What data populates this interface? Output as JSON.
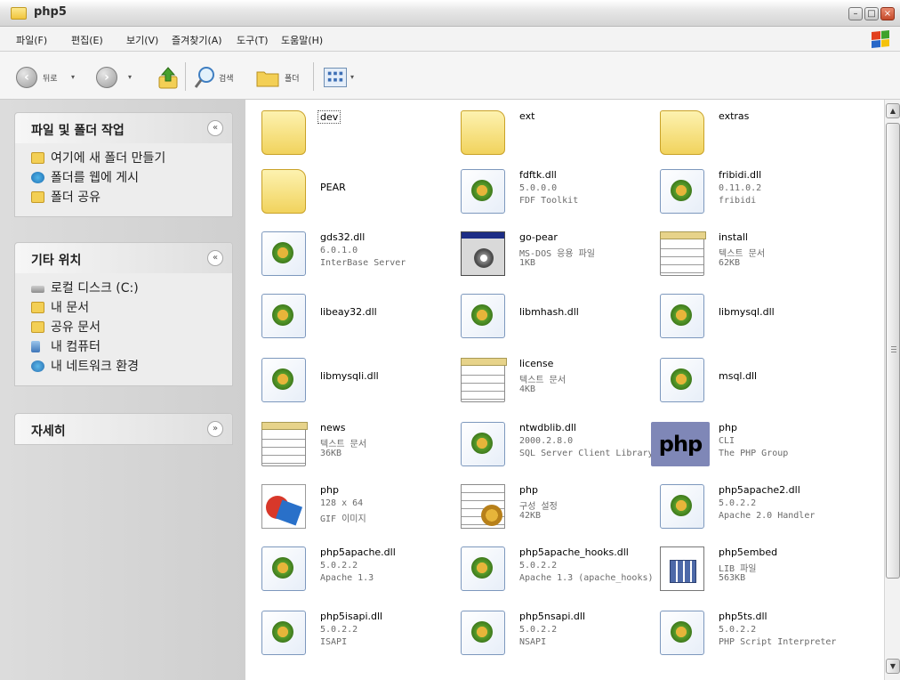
{
  "window": {
    "title": "php5"
  },
  "menu": [
    "파일(F)",
    "편집(E)",
    "보기(V)",
    "즐겨찾기(A)",
    "도구(T)",
    "도움말(H)"
  ],
  "toolbar": {
    "back_label": "뒤로",
    "search_label": "검색",
    "folders_label": "폴더"
  },
  "panels": [
    {
      "title": "파일 및 폴더 작업",
      "collapse_glyph": "«",
      "tasks": [
        {
          "label": "여기에 새 폴더 만들기",
          "icon": "new-folder-icon"
        },
        {
          "label": "폴더를 웹에 게시",
          "icon": "web-publish-icon"
        },
        {
          "label": "폴더 공유",
          "icon": "share-folder-icon"
        }
      ]
    },
    {
      "title": "기타 위치",
      "collapse_glyph": "«",
      "tasks": [
        {
          "label": "로컬 디스크 (C:)",
          "icon": "local-disk-icon"
        },
        {
          "label": "내 문서",
          "icon": "my-documents-icon"
        },
        {
          "label": "공유 문서",
          "icon": "shared-documents-icon"
        },
        {
          "label": "내 컴퓨터",
          "icon": "my-computer-icon"
        },
        {
          "label": "내 네트워크 환경",
          "icon": "my-network-icon"
        }
      ]
    },
    {
      "title": "자세히",
      "collapse_glyph": "»",
      "tasks": []
    }
  ],
  "files": [
    {
      "name": "dev",
      "line2": "",
      "line3": "",
      "icon": "folder-icon"
    },
    {
      "name": "ext",
      "line2": "",
      "line3": "",
      "icon": "folder-icon"
    },
    {
      "name": "extras",
      "line2": "",
      "line3": "",
      "icon": "folder-icon"
    },
    {
      "name": "PEAR",
      "line2": "",
      "line3": "",
      "icon": "folder-icon"
    },
    {
      "name": "fdftk.dll",
      "line2": "5.0.0.0",
      "line3": "FDF Toolkit",
      "icon": "dll-icon"
    },
    {
      "name": "fribidi.dll",
      "line2": "0.11.0.2",
      "line3": "fribidi",
      "icon": "dll-icon"
    },
    {
      "name": "gds32.dll",
      "line2": "6.0.1.0",
      "line3": "InterBase Server",
      "icon": "dll-icon"
    },
    {
      "name": "go-pear",
      "line2": "MS-DOS 응용 파일",
      "line3": "1KB",
      "icon": "msdos-icon"
    },
    {
      "name": "install",
      "line2": "텍스트 문서",
      "line3": "62KB",
      "icon": "text-document-icon"
    },
    {
      "name": "libeay32.dll",
      "line2": "",
      "line3": "",
      "icon": "dll-icon"
    },
    {
      "name": "libmhash.dll",
      "line2": "",
      "line3": "",
      "icon": "dll-icon"
    },
    {
      "name": "libmysql.dll",
      "line2": "",
      "line3": "",
      "icon": "dll-icon"
    },
    {
      "name": "libmysqli.dll",
      "line2": "",
      "line3": "",
      "icon": "dll-icon"
    },
    {
      "name": "license",
      "line2": "텍스트 문서",
      "line3": "4KB",
      "icon": "text-document-icon"
    },
    {
      "name": "msql.dll",
      "line2": "",
      "line3": "",
      "icon": "dll-icon"
    },
    {
      "name": "news",
      "line2": "텍스트 문서",
      "line3": "36KB",
      "icon": "text-document-icon"
    },
    {
      "name": "ntwdblib.dll",
      "line2": "2000.2.8.0",
      "line3": "SQL Server Client Library",
      "icon": "dll-icon"
    },
    {
      "name": "php",
      "line2": "CLI",
      "line3": "The PHP Group",
      "icon": "php-logo-icon",
      "logo_text": "php"
    },
    {
      "name": "php",
      "line2": "128 x 64",
      "line3": "GIF 이미지",
      "icon": "gif-image-icon"
    },
    {
      "name": "php",
      "line2": "구성 설정",
      "line3": "42KB",
      "icon": "config-settings-icon"
    },
    {
      "name": "php5apache2.dll",
      "line2": "5.0.2.2",
      "line3": "Apache 2.0 Handler",
      "icon": "dll-icon"
    },
    {
      "name": "php5apache.dll",
      "line2": "5.0.2.2",
      "line3": "Apache 1.3",
      "icon": "dll-icon"
    },
    {
      "name": "php5apache_hooks.dll",
      "line2": "5.0.2.2",
      "line3": "Apache 1.3 (apache_hooks)",
      "icon": "dll-icon"
    },
    {
      "name": "php5embed",
      "line2": "LIB 파일",
      "line3": "563KB",
      "icon": "lib-file-icon"
    },
    {
      "name": "php5isapi.dll",
      "line2": "5.0.2.2",
      "line3": "ISAPI",
      "icon": "dll-icon"
    },
    {
      "name": "php5nsapi.dll",
      "line2": "5.0.2.2",
      "line3": "NSAPI",
      "icon": "dll-icon"
    },
    {
      "name": "php5ts.dll",
      "line2": "5.0.2.2",
      "line3": "PHP Script Interpreter",
      "icon": "dll-icon"
    }
  ],
  "colors": {
    "selection_outline": "#555555",
    "detail_text": "#6a6a6a",
    "pane_bg": "#d6d6d6"
  }
}
